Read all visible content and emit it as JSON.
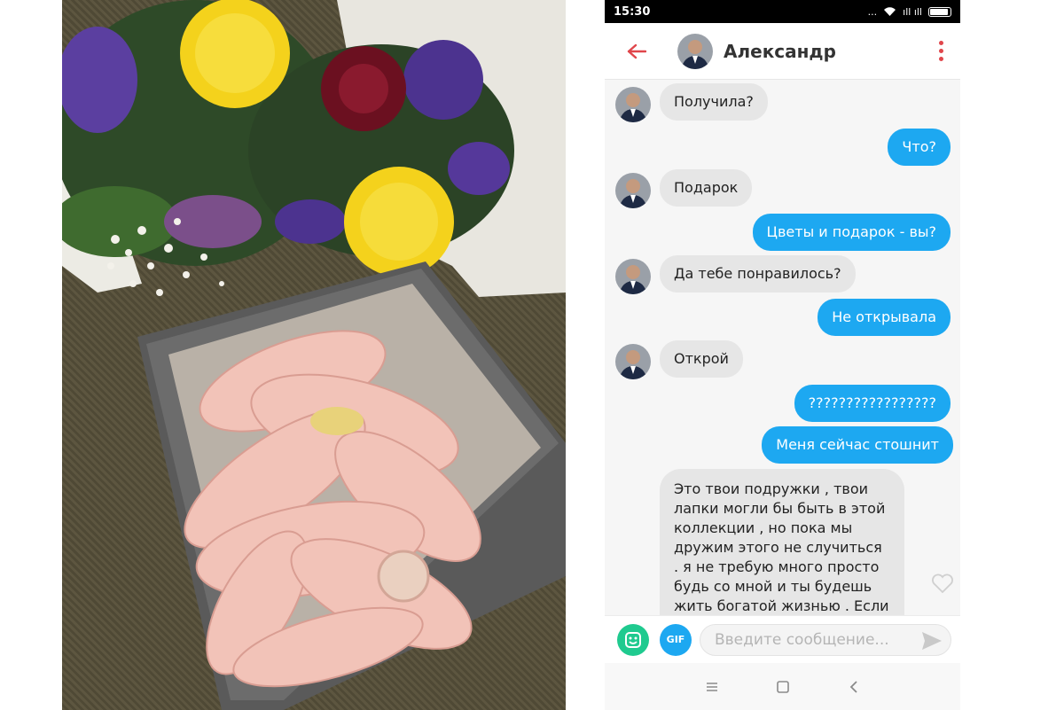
{
  "photo": {
    "description_icon": "bouquet-and-box-photo",
    "colors": {
      "background": "#5d5640",
      "box": "#6c6c6c",
      "box_inner": "#b9b1a7",
      "feet": "#f2c3b8",
      "flower_yellow": "#f4d21c",
      "flower_purple": "#5b3fa0",
      "rose": "#6b1020"
    }
  },
  "status_bar": {
    "time": "15:30",
    "dots": "...",
    "signal": "ıll ıll"
  },
  "header": {
    "contact_name": "Александр",
    "accent_color": "#e0464b"
  },
  "messages": [
    {
      "direction": "in",
      "text": "Получила?"
    },
    {
      "direction": "out",
      "text": "Что?"
    },
    {
      "direction": "in",
      "text": "Подарок"
    },
    {
      "direction": "out",
      "text": "Цветы и подарок - вы?"
    },
    {
      "direction": "in",
      "text": "Да тебе понравилось?"
    },
    {
      "direction": "out",
      "text": "Не открывала"
    },
    {
      "direction": "in",
      "text": "Открой"
    },
    {
      "direction": "out",
      "text": "?????????????????"
    },
    {
      "direction": "out",
      "text": "Меня сейчас стошнит"
    },
    {
      "direction": "in",
      "text": "Это твои подружки , твои лапки могли бы быть в этой коллекции , но пока мы дружим этого не случиться . я не требую много просто будь со мной и ты будешь жить богатой жизнью . Если"
    }
  ],
  "colors": {
    "outgoing": "#1da8f1",
    "incoming": "#e6e6e6",
    "sticker": "#1fca8f"
  },
  "input": {
    "gif_label": "GIF",
    "placeholder": "Введите сообщение..."
  },
  "nav": {
    "icons": [
      "recent-apps-icon",
      "home-icon",
      "back-nav-icon"
    ]
  }
}
